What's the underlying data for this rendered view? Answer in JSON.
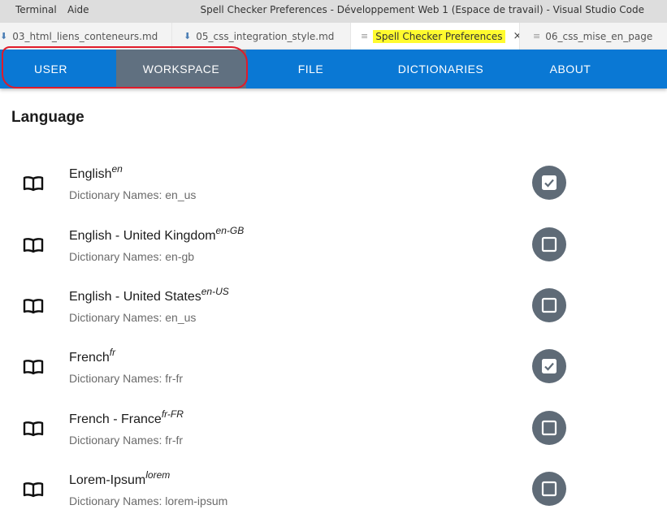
{
  "menubar": {
    "items": [
      "Terminal",
      "Aide"
    ],
    "window_title": "Spell Checker Preferences - Développement Web 1 (Espace de travail) - Visual Studio Code"
  },
  "editor_tabs": [
    {
      "label": "03_html_liens_conteneurs.md",
      "icon": "markdown-download-icon"
    },
    {
      "label": "05_css_integration_style.md",
      "icon": "markdown-download-icon"
    },
    {
      "label": "Spell Checker Preferences",
      "icon": "preview-doc-icon",
      "active": true,
      "highlighted": true,
      "close": "×"
    },
    {
      "label": "06_css_mise_en_page",
      "icon": "preview-doc-icon"
    }
  ],
  "nav_tabs": [
    {
      "label": "USER",
      "active": false
    },
    {
      "label": "WORKSPACE",
      "active": true
    },
    {
      "label": "FILE",
      "active": false
    },
    {
      "label": "DICTIONARIES",
      "active": false
    },
    {
      "label": "ABOUT",
      "active": false
    }
  ],
  "section_title": "Language",
  "dict_prefix": "Dictionary Names:",
  "languages": [
    {
      "name": "English",
      "code": "en",
      "dictionaries": "en_us",
      "checked": true
    },
    {
      "name": "English - United Kingdom",
      "code": "en-GB",
      "dictionaries": "en-gb",
      "checked": false
    },
    {
      "name": "English - United States",
      "code": "en-US",
      "dictionaries": "en_us",
      "checked": false
    },
    {
      "name": "French",
      "code": "fr",
      "dictionaries": "fr-fr",
      "checked": true
    },
    {
      "name": "French - France",
      "code": "fr-FR",
      "dictionaries": "fr-fr",
      "checked": false
    },
    {
      "name": "Lorem-Ipsum",
      "code": "lorem",
      "dictionaries": "lorem-ipsum",
      "checked": false
    }
  ],
  "colors": {
    "nav_background": "#0a78d4",
    "nav_active": "#607080",
    "toggle": "#5f6b77",
    "annotation": "#e01b2a",
    "tab_highlight": "#fffb2e"
  }
}
